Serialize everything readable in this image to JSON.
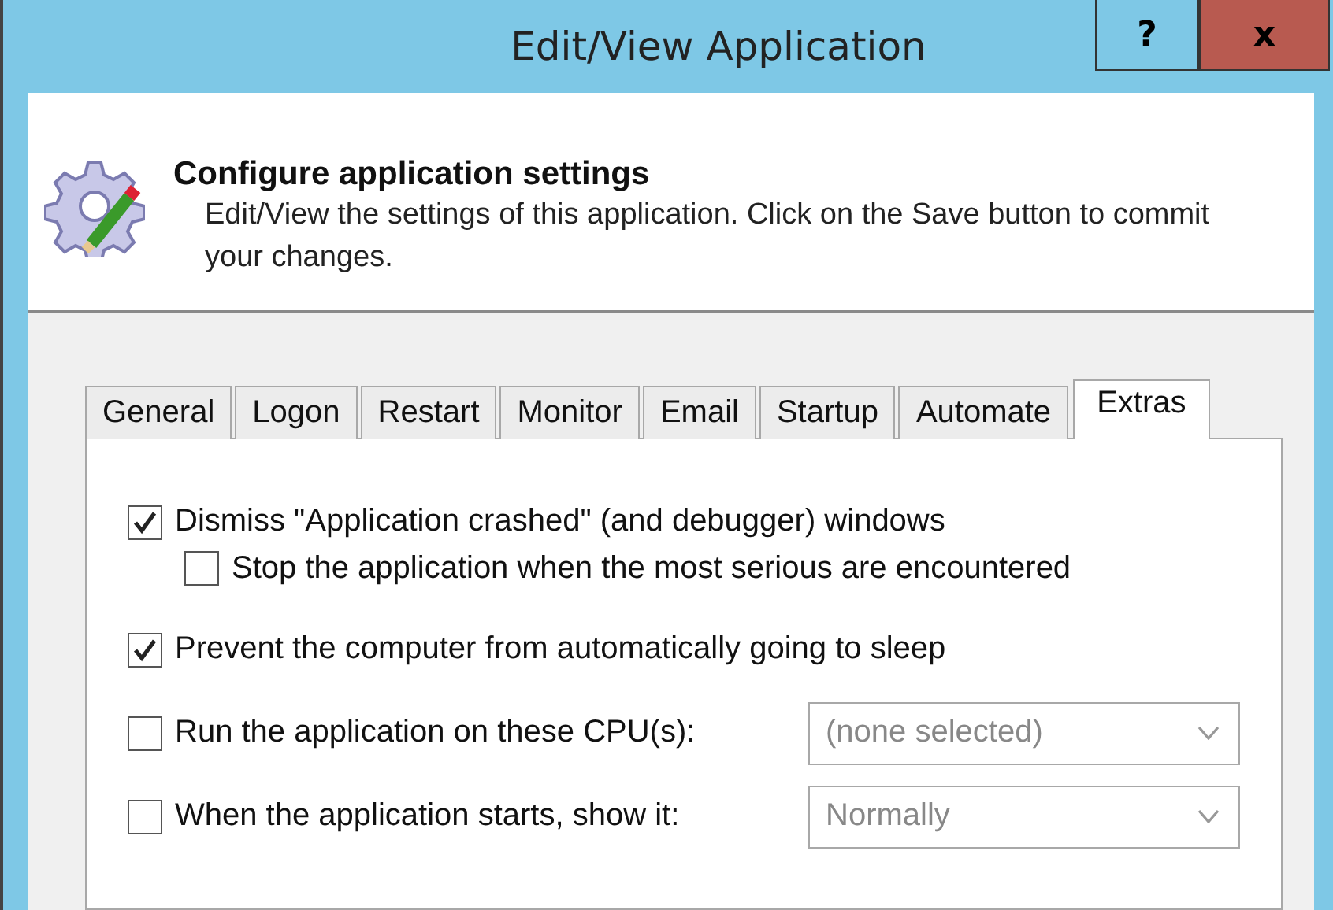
{
  "window": {
    "title": "Edit/View Application",
    "help_button": "?",
    "close_button": "x"
  },
  "header": {
    "title": "Configure application settings",
    "description": "Edit/View the settings of this application. Click on the Save button to commit your changes."
  },
  "tabs": [
    {
      "label": "General",
      "selected": false
    },
    {
      "label": "Logon",
      "selected": false
    },
    {
      "label": "Restart",
      "selected": false
    },
    {
      "label": "Monitor",
      "selected": false
    },
    {
      "label": "Email",
      "selected": false
    },
    {
      "label": "Startup",
      "selected": false
    },
    {
      "label": "Automate",
      "selected": false
    },
    {
      "label": "Extras",
      "selected": true
    }
  ],
  "options": [
    {
      "kind": "checkbox",
      "label": "Dismiss \"Application crashed\" (and debugger) windows",
      "checked": true,
      "children": [
        {
          "kind": "checkbox",
          "label": "Stop the application when the most serious are encountered",
          "checked": false
        }
      ]
    },
    {
      "kind": "checkbox",
      "label": "Prevent the computer from automatically going to sleep",
      "checked": true
    },
    {
      "kind": "dropdown",
      "label": "Run the application on these CPU(s):",
      "checked": false,
      "value": "(none selected)"
    },
    {
      "kind": "dropdown",
      "label": "When the application starts, show it:",
      "checked": false,
      "value": "Normally"
    }
  ]
}
